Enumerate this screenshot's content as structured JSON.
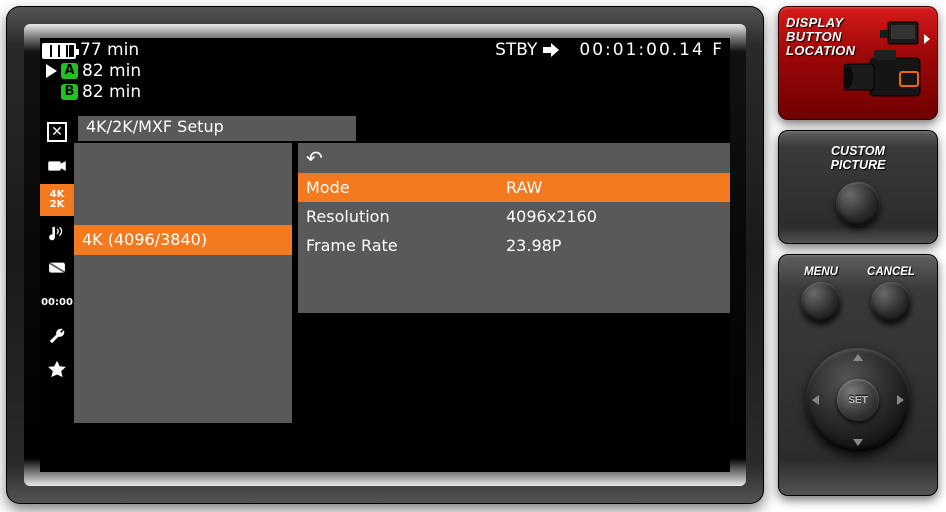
{
  "status": {
    "battery_remaining": "77 min",
    "slot_a_label": "A",
    "slot_a_time": "82 min",
    "slot_b_label": "B",
    "slot_b_time": "82 min",
    "rec_state": "STBY",
    "timecode": "00:01:00.14 F"
  },
  "menu": {
    "title": "4K/2K/MXF Setup",
    "category_selected": "4K (4096/3840)",
    "settings": [
      {
        "key": "Mode",
        "value": "RAW",
        "selected": true
      },
      {
        "key": "Resolution",
        "value": "4096x2160",
        "selected": false
      },
      {
        "key": "Frame Rate",
        "value": "23.98P",
        "selected": false
      }
    ],
    "icon_col": [
      {
        "name": "close",
        "selected": false
      },
      {
        "name": "camera",
        "selected": false
      },
      {
        "name": "4k2k",
        "selected": true
      },
      {
        "name": "audio",
        "selected": false
      },
      {
        "name": "monitor",
        "selected": false
      },
      {
        "name": "tc",
        "selected": false
      },
      {
        "name": "wrench",
        "selected": false
      },
      {
        "name": "star",
        "selected": false
      }
    ]
  },
  "side": {
    "display_button_location": "DISPLAY\nBUTTON\nLOCATION",
    "custom_picture": "CUSTOM\nPICTURE",
    "menu_label": "MENU",
    "cancel_label": "CANCEL",
    "set_label": "SET"
  }
}
